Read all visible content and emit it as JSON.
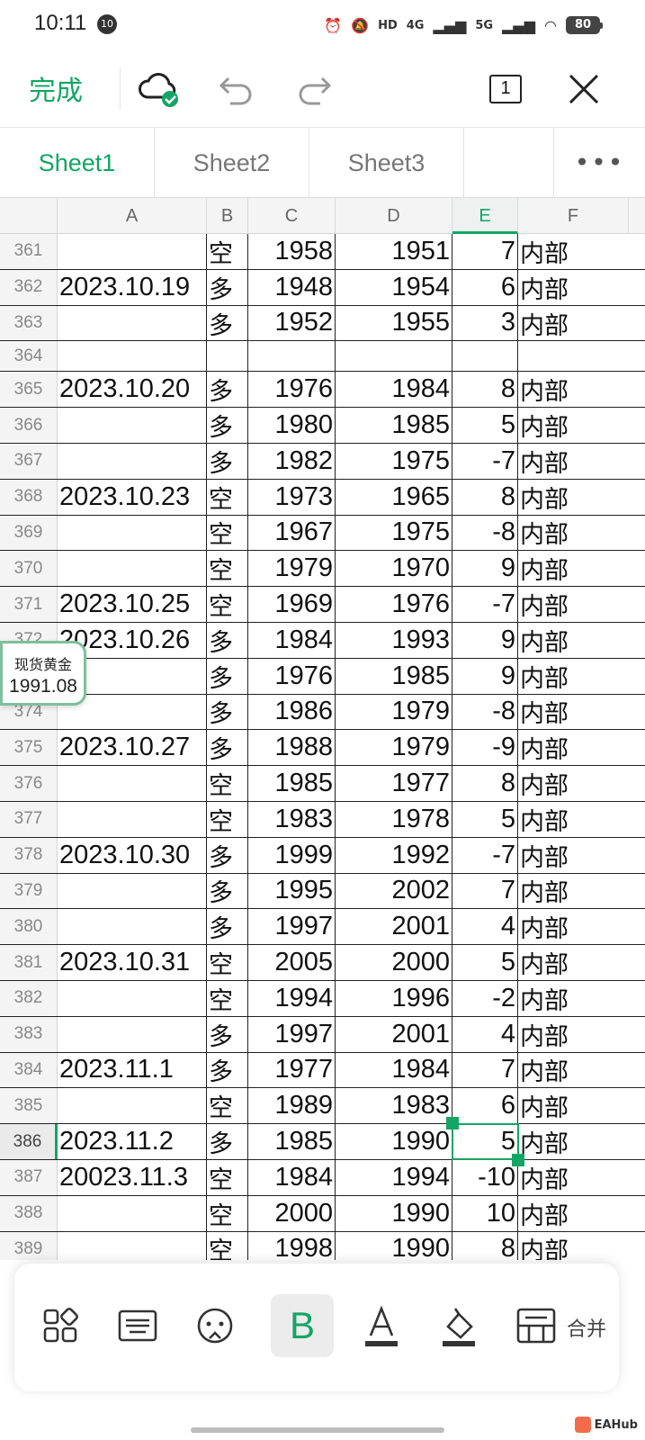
{
  "status_bar": {
    "time": "10:11",
    "notif_badge": "10",
    "network_1": "4G",
    "network_2": "5G",
    "battery": "80"
  },
  "toolbar": {
    "done_label": "完成",
    "page_count": "1"
  },
  "sheet_tabs": [
    "Sheet1",
    "Sheet2",
    "Sheet3"
  ],
  "tabs_more": "•••",
  "columns": [
    "A",
    "B",
    "C",
    "D",
    "E",
    "F"
  ],
  "rows": [
    {
      "n": "361",
      "a": "",
      "b": "空",
      "c": "1958",
      "d": "1951",
      "e": "7",
      "f": "内部"
    },
    {
      "n": "362",
      "a": "2023.10.19",
      "b": "多",
      "c": "1948",
      "d": "1954",
      "e": "6",
      "f": "内部"
    },
    {
      "n": "363",
      "a": "",
      "b": "多",
      "c": "1952",
      "d": "1955",
      "e": "3",
      "f": "内部"
    },
    {
      "n": "364",
      "a": "",
      "b": "",
      "c": "",
      "d": "",
      "e": "",
      "f": "",
      "empty": true
    },
    {
      "n": "365",
      "a": "2023.10.20",
      "b": "多",
      "c": "1976",
      "d": "1984",
      "e": "8",
      "f": "内部"
    },
    {
      "n": "366",
      "a": "",
      "b": "多",
      "c": "1980",
      "d": "1985",
      "e": "5",
      "f": "内部"
    },
    {
      "n": "367",
      "a": "",
      "b": "多",
      "c": "1982",
      "d": "1975",
      "e": "-7",
      "f": "内部"
    },
    {
      "n": "368",
      "a": "2023.10.23",
      "b": "空",
      "c": "1973",
      "d": "1965",
      "e": "8",
      "f": "内部"
    },
    {
      "n": "369",
      "a": "",
      "b": "空",
      "c": "1967",
      "d": "1975",
      "e": "-8",
      "f": "内部"
    },
    {
      "n": "370",
      "a": "",
      "b": "空",
      "c": "1979",
      "d": "1970",
      "e": "9",
      "f": "内部"
    },
    {
      "n": "371",
      "a": "2023.10.25",
      "b": "空",
      "c": "1969",
      "d": "1976",
      "e": "-7",
      "f": "内部"
    },
    {
      "n": "372",
      "a": "2023.10.26",
      "b": "多",
      "c": "1984",
      "d": "1993",
      "e": "9",
      "f": "内部"
    },
    {
      "n": "373",
      "a": "",
      "b": "多",
      "c": "1976",
      "d": "1985",
      "e": "9",
      "f": "内部"
    },
    {
      "n": "374",
      "a": "",
      "b": "多",
      "c": "1986",
      "d": "1979",
      "e": "-8",
      "f": "内部"
    },
    {
      "n": "375",
      "a": "2023.10.27",
      "b": "多",
      "c": "1988",
      "d": "1979",
      "e": "-9",
      "f": "内部"
    },
    {
      "n": "376",
      "a": "",
      "b": "空",
      "c": "1985",
      "d": "1977",
      "e": "8",
      "f": "内部"
    },
    {
      "n": "377",
      "a": "",
      "b": "空",
      "c": "1983",
      "d": "1978",
      "e": "5",
      "f": "内部"
    },
    {
      "n": "378",
      "a": "2023.10.30",
      "b": "多",
      "c": "1999",
      "d": "1992",
      "e": "-7",
      "f": "内部"
    },
    {
      "n": "379",
      "a": "",
      "b": "多",
      "c": "1995",
      "d": "2002",
      "e": "7",
      "f": "内部"
    },
    {
      "n": "380",
      "a": "",
      "b": "多",
      "c": "1997",
      "d": "2001",
      "e": "4",
      "f": "内部"
    },
    {
      "n": "381",
      "a": "2023.10.31",
      "b": "空",
      "c": "2005",
      "d": "2000",
      "e": "5",
      "f": "内部"
    },
    {
      "n": "382",
      "a": "",
      "b": "空",
      "c": "1994",
      "d": "1996",
      "e": "-2",
      "f": "内部"
    },
    {
      "n": "383",
      "a": "",
      "b": "多",
      "c": "1997",
      "d": "2001",
      "e": "4",
      "f": "内部"
    },
    {
      "n": "384",
      "a": "2023.11.1",
      "b": "多",
      "c": "1977",
      "d": "1984",
      "e": "7",
      "f": "内部"
    },
    {
      "n": "385",
      "a": "",
      "b": "空",
      "c": "1989",
      "d": "1983",
      "e": "6",
      "f": "内部"
    },
    {
      "n": "386",
      "a": "2023.11.2",
      "b": "多",
      "c": "1985",
      "d": "1990",
      "e": "5",
      "f": "内部",
      "selected": true
    },
    {
      "n": "387",
      "a": "20023.11.3",
      "b": "空",
      "c": "1984",
      "d": "1994",
      "e": "-10",
      "f": "内部"
    },
    {
      "n": "388",
      "a": "",
      "b": "空",
      "c": "2000",
      "d": "1990",
      "e": "10",
      "f": "内部"
    },
    {
      "n": "389",
      "a": "",
      "b": "空",
      "c": "1998",
      "d": "1990",
      "e": "8",
      "f": "内部"
    }
  ],
  "price_bubble": {
    "title": "现货黄金",
    "value": "1991.08"
  },
  "bottom_toolbar": {
    "merge_label": "合并"
  },
  "watermark": "EAHub",
  "colors": {
    "accent": "#13a564",
    "grid_line": "#222222",
    "header_bg": "#f4f4f4"
  }
}
